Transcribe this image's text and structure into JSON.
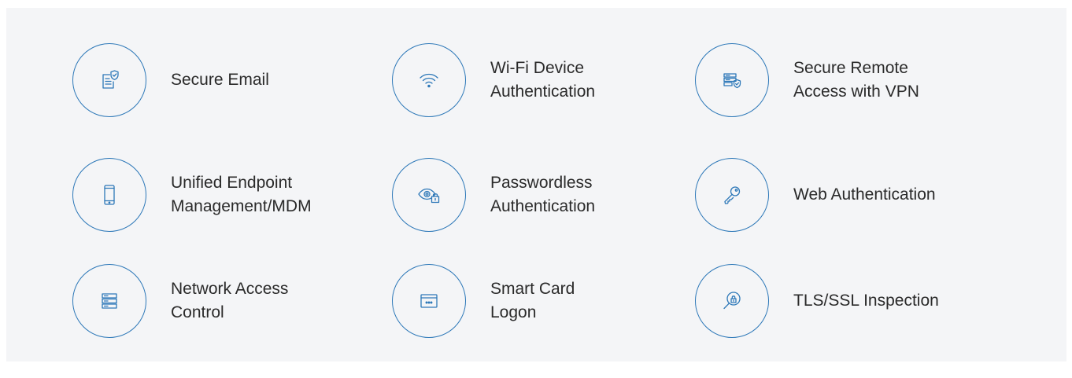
{
  "colors": {
    "accent": "#2d78b8",
    "background": "#f4f5f7",
    "text": "#2a2a2a"
  },
  "features": [
    {
      "label": "Secure Email",
      "icon": "email-shield-icon"
    },
    {
      "label": "Wi-Fi Device\nAuthentication",
      "icon": "wifi-icon"
    },
    {
      "label": "Secure Remote\nAccess with VPN",
      "icon": "server-shield-icon"
    },
    {
      "label": "Unified Endpoint\nManagement/MDM",
      "icon": "smartphone-icon"
    },
    {
      "label": "Passwordless\nAuthentication",
      "icon": "eye-lock-icon"
    },
    {
      "label": "Web Authentication",
      "icon": "key-icon"
    },
    {
      "label": "Network Access\nControl",
      "icon": "server-stack-icon"
    },
    {
      "label": "Smart Card\nLogon",
      "icon": "smart-card-icon"
    },
    {
      "label": "TLS/SSL Inspection",
      "icon": "magnifier-lock-icon"
    }
  ]
}
